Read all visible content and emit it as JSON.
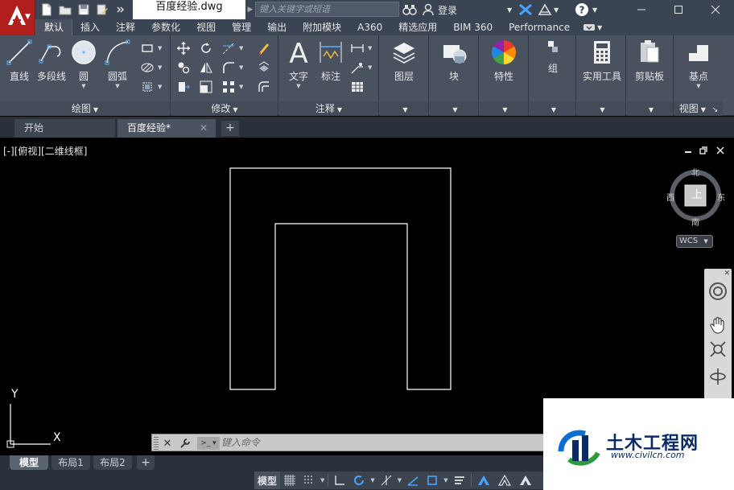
{
  "title_bar": {
    "doc_title": "百度经验.dwg",
    "search_placeholder": "键入关键字或短语",
    "login_label": "登录"
  },
  "ribbon_tabs": [
    "默认",
    "插入",
    "注释",
    "参数化",
    "视图",
    "管理",
    "输出",
    "附加模块",
    "A360",
    "精选应用",
    "BIM 360",
    "Performance"
  ],
  "ribbon": {
    "draw": {
      "title": "绘图",
      "tools": [
        "直线",
        "多段线",
        "圆",
        "圆弧"
      ]
    },
    "modify": {
      "title": "修改"
    },
    "annotation": {
      "title": "注释",
      "tools": [
        "文字",
        "标注"
      ]
    },
    "layers": {
      "label": "图层"
    },
    "block": {
      "label": "块"
    },
    "properties": {
      "label": "特性"
    },
    "groups": {
      "label": "组"
    },
    "utilities": {
      "label": "实用工具"
    },
    "clipboard": {
      "label": "剪贴板"
    },
    "view": {
      "title": "视图",
      "tool": "基点"
    }
  },
  "file_tabs": {
    "start": "开始",
    "active": "百度经验*"
  },
  "viewport": {
    "label": "[-][俯视][二维线框]",
    "viewcube": {
      "top_face": "上",
      "north": "北",
      "south": "南",
      "east": "东",
      "west": "西"
    },
    "wcs_label": "WCS",
    "ucs_y": "Y",
    "ucs_x": "X"
  },
  "command_line": {
    "placeholder": "键入命令"
  },
  "layout_tabs": [
    "模型",
    "布局1",
    "布局2"
  ],
  "status_bar": {
    "model": "模型"
  },
  "watermark": {
    "brand": "土木工程网",
    "url": "www.civilcn.com"
  },
  "colors": {
    "title_bar": "#3b4453",
    "ribbon": "#4a5260",
    "app_button": "#b01e1e",
    "canvas": "#000000",
    "drawing_lines": "#ffffff"
  }
}
